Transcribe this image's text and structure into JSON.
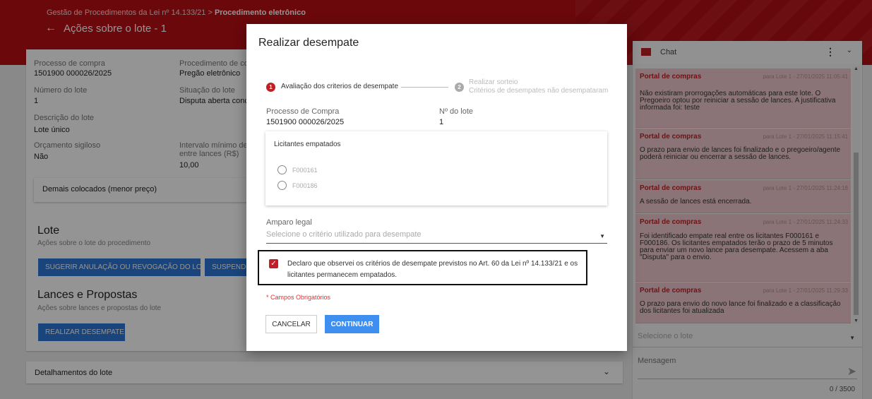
{
  "header": {
    "breadcrumb_prefix": "Gestão de Procedimentos da Lei nº 14.133/21 > ",
    "breadcrumb_current": "Procedimento eletrônico",
    "back_arrow": "←",
    "page_title": "Ações sobre o lote - 1"
  },
  "details": {
    "processo_label": "Processo de compra",
    "processo_value": "1501900 000026/2025",
    "procedimento_label": "Procedimento de con",
    "procedimento_value": "Pregão eletrônico",
    "numero_lote_label": "Número do lote",
    "numero_lote_value": "1",
    "situacao_label": "Situação do lote",
    "situacao_value": "Disputa aberta concl",
    "descricao_label": "Descrição do lote",
    "descricao_value": "Lote único",
    "orcamento_label": "Orçamento sigiloso",
    "orcamento_value": "Não",
    "intervalo_label_1": "Intervalo mínimo de d",
    "intervalo_label_2": "entre lances (R$)",
    "intervalo_value": "10,00",
    "demais_colocados": "Demais colocados (menor preço)"
  },
  "lote_section": {
    "title": "Lote",
    "subtitle": "Ações sobre o lote do procedimento",
    "btn_sugerir": "SUGERIR ANULAÇÃO OU REVOGAÇÃO DO LOTE",
    "btn_suspender": "SUSPENDER"
  },
  "lances_section": {
    "title": "Lances e Propostas",
    "subtitle": "Ações sobre lances e propostas do lote",
    "btn_desempate": "REALIZAR DESEMPATE"
  },
  "detalhamentos": {
    "label": "Detalhamentos do lote",
    "chevron": "⌄"
  },
  "chat": {
    "title": "Chat",
    "more": "⋮",
    "collapse": "⌄",
    "scroll_up": "▲",
    "scroll_down": "▼",
    "messages": [
      {
        "from": "Portal de compras",
        "meta": "para Lote 1 - 27/01/2025 11:05:41",
        "text": "Não existiram prorrogações automáticas para este lote. O Pregoeiro optou por reiniciar a sessão de lances. A justificativa informada foi: teste"
      },
      {
        "from": "Portal de compras",
        "meta": "para Lote 1 - 27/01/2025 11:15:41",
        "text": "O prazo para envio de lances foi finalizado e o pregoeiro/agente poderá reiniciar ou encerrar a sessão de lances."
      },
      {
        "from": "Portal de compras",
        "meta": "para Lote 1 - 27/01/2025 11:24:18",
        "text": "A sessão de lances está encerrada."
      },
      {
        "from": "Portal de compras",
        "meta": "para Lote 1 - 27/01/2025 11:24:33",
        "text": "Foi identificado empate real entre os licitantes F000161 e F000186. Os licitantes empatados terão o prazo de 5 minutos para enviar um novo lance para desempate. Acessem a aba \"Disputa\" para o envio."
      },
      {
        "from": "Portal de compras",
        "meta": "para Lote 1 - 27/01/2025 11:29:33",
        "text": "O prazo para envio do novo lance foi finalizado e a classificação dos licitantes foi atualizada"
      }
    ],
    "lote_placeholder": "Selecione o lote",
    "message_label": "Mensagem",
    "send_icon": "➤",
    "counter": "0 / 3500"
  },
  "modal": {
    "title": "Realizar desempate",
    "step1_number": "1",
    "step1_label": "Avaliação dos criterios de desempate",
    "step2_number": "2",
    "step2_title": "Realizar sorteio",
    "step2_subtitle": "Critérios de desempates não desempataram",
    "processo_label": "Processo de Compra",
    "processo_value": "1501900 000026/2025",
    "lote_label": "Nº do lote",
    "lote_value": "1",
    "licitantes_title": "Licitantes empatados",
    "licitantes": [
      "F000161",
      "F000186"
    ],
    "amparo_label": "Amparo legal",
    "amparo_placeholder": "Selecione o critério utilizado para desempate",
    "declaracao": "Declaro que observei os critérios de desempate previstos no Art. 60 da Lei nº 14.133/21 e os licitantes permanecem empatados.",
    "check_mark": "✓",
    "required_note": "* Campos Obrigatórios",
    "btn_cancel": "CANCELAR",
    "btn_continue": "CONTINUAR"
  },
  "colors": {
    "brand_red": "#b80f16",
    "primary_blue": "#2b78d6",
    "chat_bubble": "#efc9cd"
  }
}
